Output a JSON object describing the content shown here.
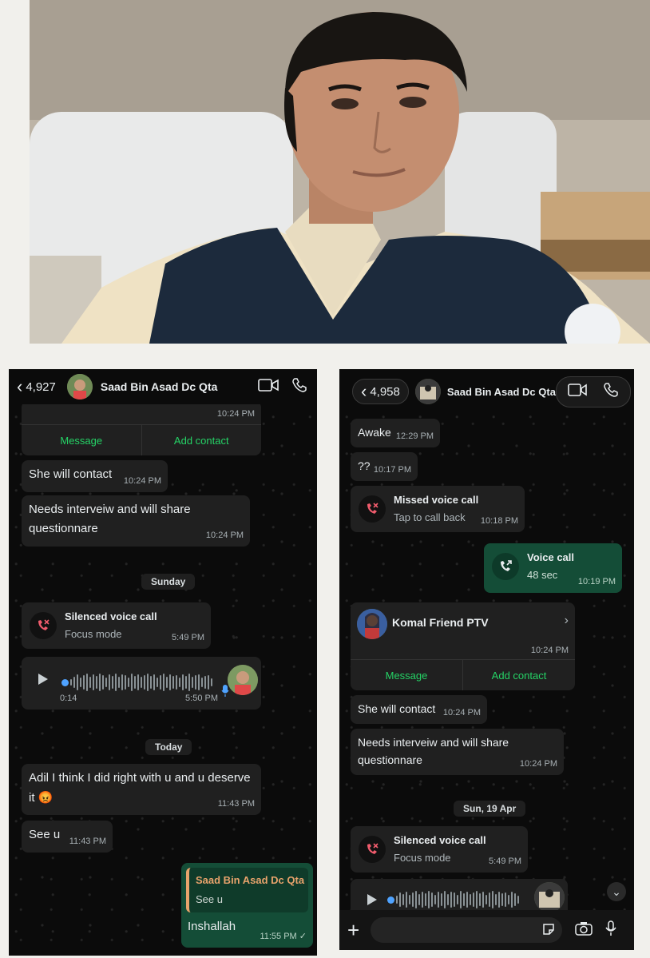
{
  "left_chat": {
    "back_count": "4,927",
    "contact_name": "Saad Bin Asad Dc Qta",
    "card_time": "10:24 PM",
    "card_message_btn": "Message",
    "card_add_contact_btn": "Add contact",
    "messages": [
      {
        "text": "She will contact",
        "time": "10:24 PM"
      },
      {
        "text": "Needs interveiw and will share questionnare",
        "time": "10:24 PM"
      }
    ],
    "day_sunday": "Sunday",
    "silenced_call": {
      "title": "Silenced voice call",
      "sub": "Focus mode",
      "time": "5:49 PM"
    },
    "voice_note": {
      "duration": "0:14",
      "time": "5:50 PM"
    },
    "day_today": "Today",
    "msg_adil": {
      "text": "Adil I think I did right with u and u deserve it 😡",
      "time": "11:43 PM"
    },
    "msg_see_u": {
      "text": "See u",
      "time": "11:43 PM"
    },
    "reply": {
      "quoted_name": "Saad Bin Asad Dc Qta",
      "quoted_text": "See u",
      "text": "Inshallah",
      "time": "11:55 PM ✓"
    }
  },
  "right_chat": {
    "back_count": "4,958",
    "contact_name": "Saad Bin Asad Dc Qta",
    "msg_awake": {
      "text": "Awake",
      "time": "12:29 PM"
    },
    "msg_qq": {
      "text": "??",
      "time": "10:17 PM"
    },
    "missed_call": {
      "title": "Missed voice call",
      "sub": "Tap to call back",
      "time": "10:18 PM"
    },
    "voice_call": {
      "title": "Voice call",
      "sub": "48 sec",
      "time": "10:19 PM"
    },
    "contact_card": {
      "name": "Komal Friend PTV",
      "time": "10:24 PM",
      "message_btn": "Message",
      "add_contact_btn": "Add contact"
    },
    "msg_contact": {
      "text": "She will contact",
      "time": "10:24 PM"
    },
    "msg_needs": {
      "text": "Needs interveiw and will share questionnare",
      "time": "10:24 PM"
    },
    "day_label": "Sun, 19 Apr",
    "silenced_call": {
      "title": "Silenced voice call",
      "sub": "Focus mode",
      "time": "5:49 PM"
    }
  },
  "colors": {
    "accent": "#25d366",
    "outgoing": "#144d37",
    "incoming": "#202020",
    "missed": "#f15c6d"
  }
}
